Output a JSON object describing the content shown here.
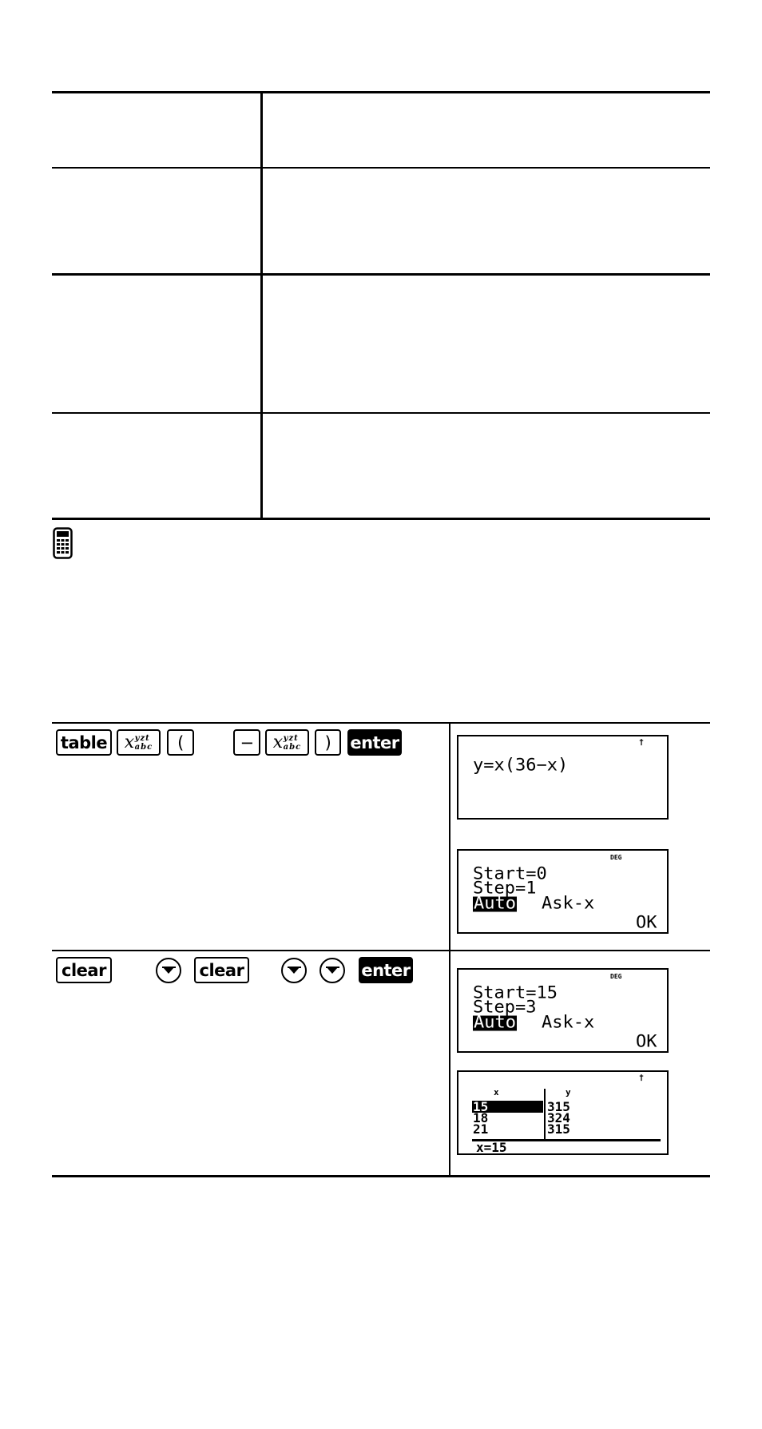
{
  "top_table": {
    "rows": [
      {
        "left": "",
        "right": ""
      },
      {
        "left": "",
        "right": ""
      },
      {
        "left": "",
        "right": ""
      },
      {
        "left": "",
        "right": ""
      }
    ]
  },
  "note_icon": "calculator-icon",
  "steps": [
    {
      "keys": [
        {
          "type": "key",
          "label": "table"
        },
        {
          "type": "xkey",
          "base": "x",
          "sup": "yzt",
          "sub": "abc"
        },
        {
          "type": "key",
          "label": "("
        },
        {
          "type": "key",
          "label": "−"
        },
        {
          "type": "xkey",
          "base": "x",
          "sup": "yzt",
          "sub": "abc"
        },
        {
          "type": "key",
          "label": ")"
        },
        {
          "type": "dark-key",
          "label": "enter"
        }
      ],
      "screens": [
        {
          "indicator": "†",
          "lines": [
            "y=x(36−x)"
          ]
        },
        {
          "indicator": "DEG",
          "lines": [
            "Start=0",
            "Step=1"
          ],
          "options": {
            "selected": "Auto",
            "other": "Ask-x"
          },
          "action": "OK"
        }
      ]
    },
    {
      "keys": [
        {
          "type": "key",
          "label": "clear"
        },
        {
          "type": "arrow",
          "icon": "down-arrow-icon"
        },
        {
          "type": "key",
          "label": "clear"
        },
        {
          "type": "arrow",
          "icon": "down-arrow-icon"
        },
        {
          "type": "arrow",
          "icon": "down-arrow-icon"
        },
        {
          "type": "dark-key",
          "label": "enter"
        }
      ],
      "screens": [
        {
          "indicator": "DEG",
          "lines": [
            "Start=15",
            "Step=3"
          ],
          "options": {
            "selected": "Auto",
            "other": "Ask-x"
          },
          "action": "OK"
        },
        {
          "indicator": "†",
          "table": {
            "headers": [
              "x",
              "y"
            ],
            "rows": [
              [
                "15",
                "315"
              ],
              [
                "18",
                "324"
              ],
              [
                "21",
                "315"
              ]
            ],
            "selected_row": 0
          },
          "status": "x=15"
        }
      ]
    }
  ]
}
